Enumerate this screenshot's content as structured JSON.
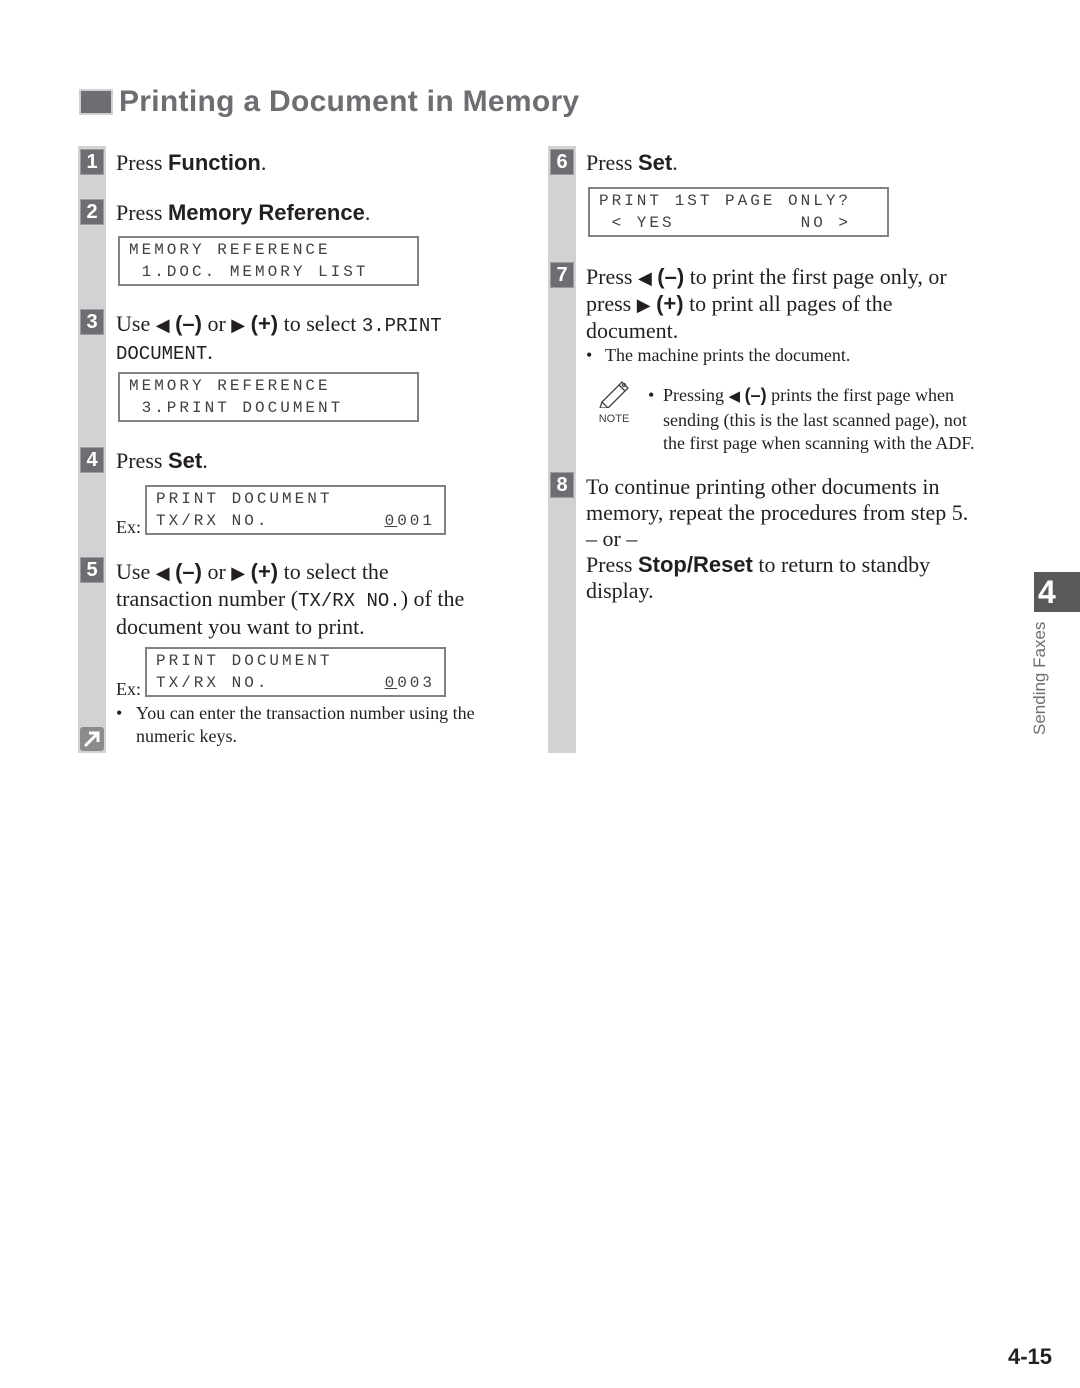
{
  "page": {
    "title": "Printing a Document in Memory",
    "chapter_tab": "4",
    "chapter_label": "Sending Faxes",
    "page_number": "4-15"
  },
  "glyphs": {
    "left": "◀",
    "right": "▶"
  },
  "steps": {
    "s1": {
      "num": "1",
      "pre": "Press ",
      "bold": "Function",
      "post": "."
    },
    "s2": {
      "num": "2",
      "pre": "Press ",
      "bold": "Memory Reference",
      "post": ".",
      "lcd": {
        "line1": "MEMORY REFERENCE",
        "line2": " 1.DOC. MEMORY LIST"
      }
    },
    "s3": {
      "num": "3",
      "use": "Use ",
      "minus": "(–)",
      "or": " or ",
      "plus": "(+)",
      "select": " to select ",
      "mono1": "3.PRINT",
      "mono2": "DOCUMENT",
      "post": ".",
      "lcd": {
        "line1": "MEMORY REFERENCE",
        "line2": " 3.PRINT DOCUMENT"
      }
    },
    "s4": {
      "num": "4",
      "pre": "Press ",
      "bold": "Set",
      "post": ".",
      "ex": "Ex:",
      "lcd": {
        "line1": "PRINT DOCUMENT",
        "line2_label": "TX/RX NO.",
        "cursor": "0",
        "rest": "001"
      }
    },
    "s5": {
      "num": "5",
      "use": "Use ",
      "minus": "(–)",
      "or": " or ",
      "plus": "(+)",
      "select": " to select the",
      "line2a": "transaction number (",
      "line2mono": "TX/RX NO.",
      "line2b": ") of the",
      "line3": "document you want to print.",
      "ex": "Ex:",
      "lcd": {
        "line1": "PRINT DOCUMENT",
        "line2_label": "TX/RX NO.",
        "cursor": "0",
        "rest": "003"
      },
      "bullet": "You can enter the transaction number using the numeric keys."
    },
    "s6": {
      "num": "6",
      "pre": "Press ",
      "bold": "Set",
      "post": ".",
      "lcd": {
        "line1": "PRINT 1ST PAGE ONLY?",
        "line2": " < YES          NO >"
      }
    },
    "s7": {
      "num": "7",
      "press": "Press ",
      "minus": "(–)",
      "mid": " to print the first page only, or",
      "press2": "press ",
      "plus": "(+)",
      "mid2": " to print all pages of the",
      "line3": "document.",
      "bullet": "The machine prints the document.",
      "note_label": "NOTE",
      "note_pre": "Pressing ",
      "note_minus": "(–)",
      "note_post": " prints the first page when",
      "note_line2": "sending (this is the last scanned page), not",
      "note_line3": "the first page when scanning with the ADF."
    },
    "s8": {
      "num": "8",
      "line1": "To continue printing other documents in",
      "line2": "memory, repeat the procedures from step 5.",
      "or": "– or –",
      "pre": "Press ",
      "bold": "Stop/Reset",
      "post": " to return to standby",
      "line5": "display."
    }
  }
}
